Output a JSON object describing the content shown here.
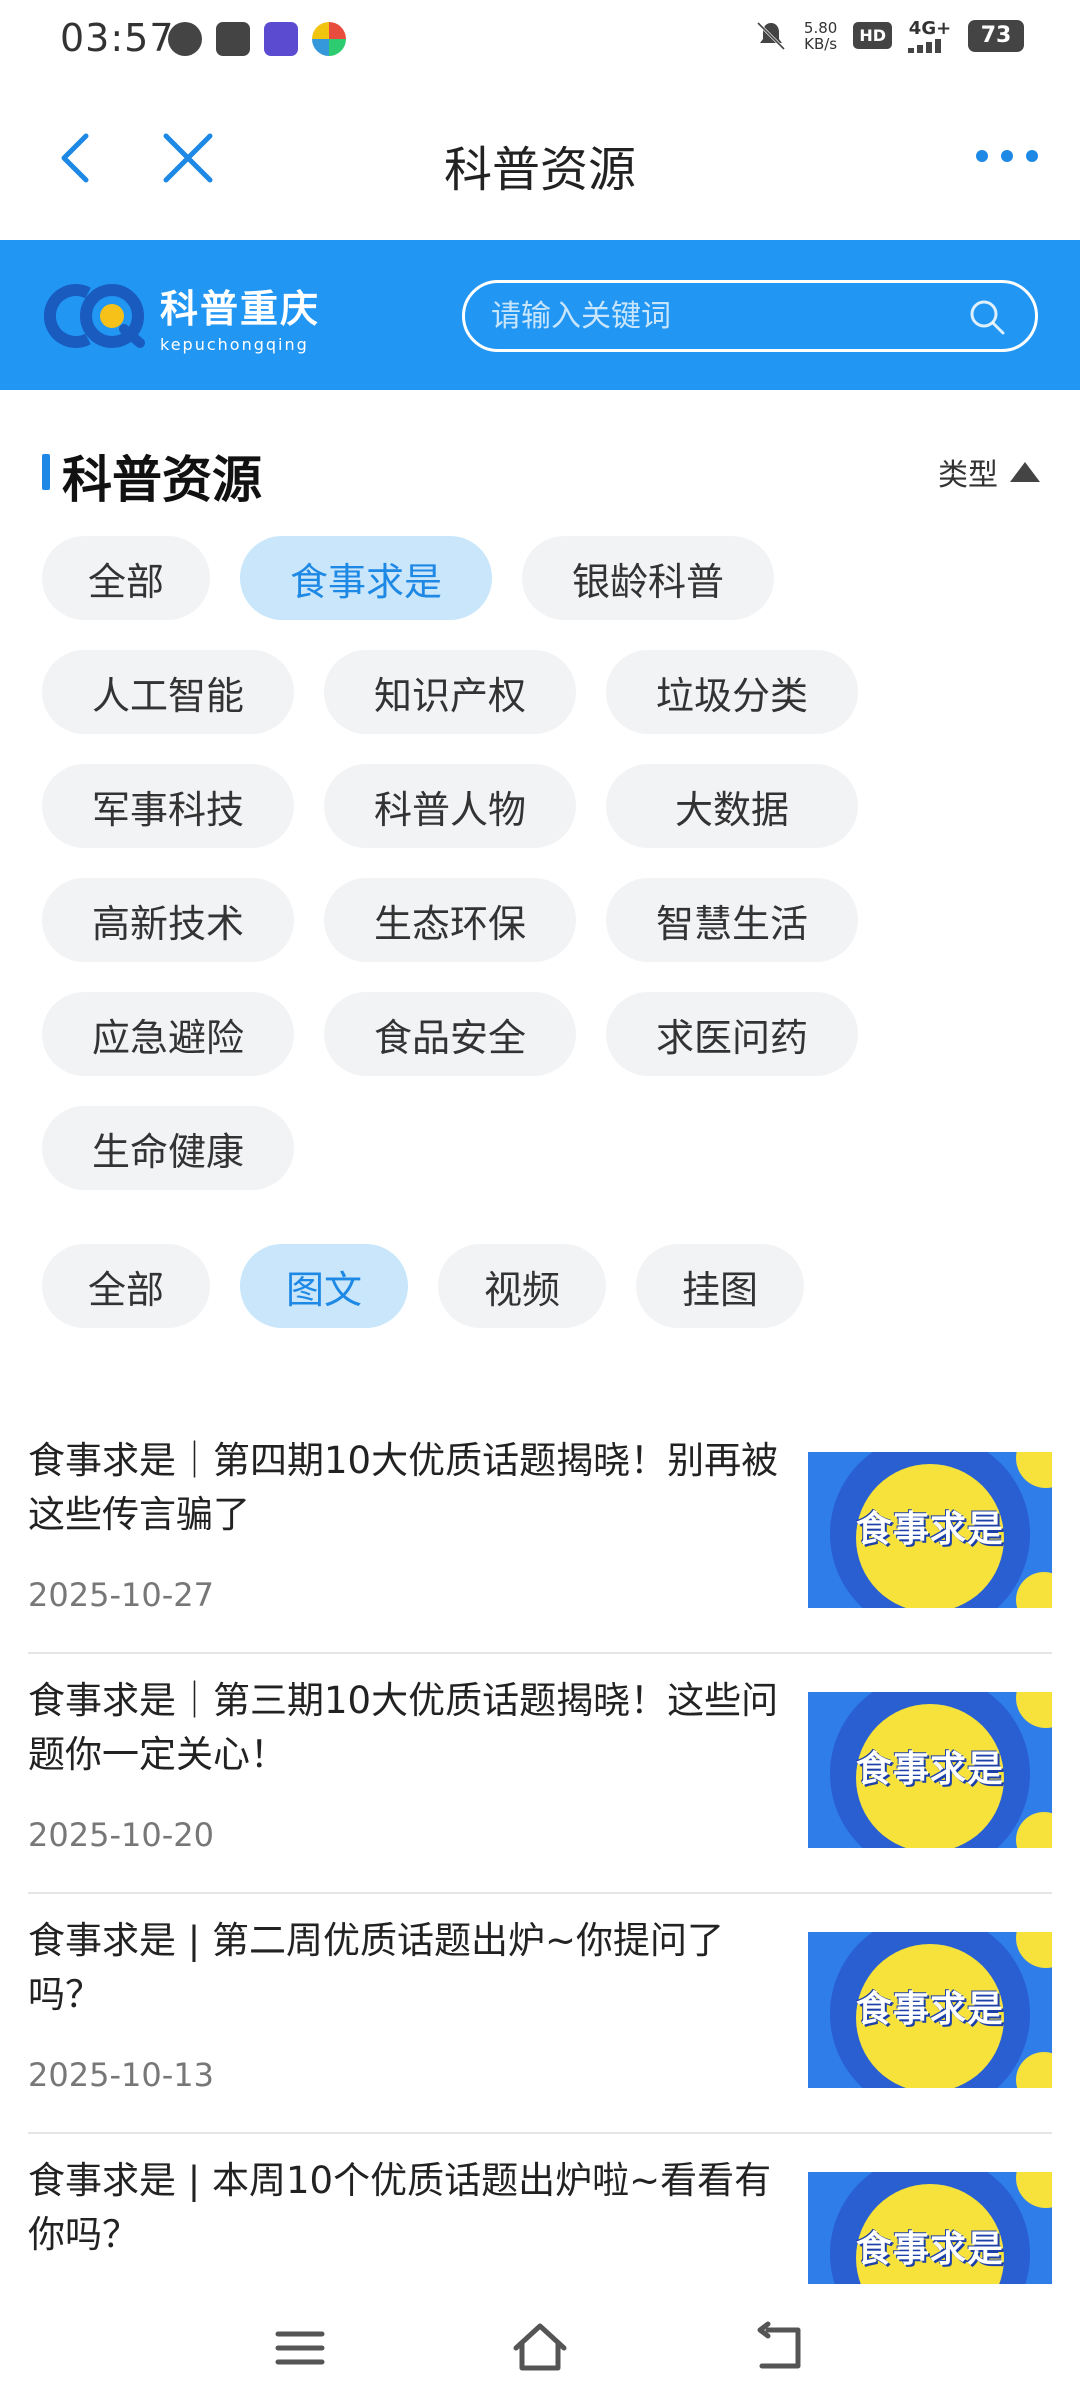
{
  "status_bar": {
    "time": "03:57",
    "net_speed_value": "5.80",
    "net_speed_unit": "KB/s",
    "hd_label": "HD",
    "network_label": "4G+",
    "battery": "73",
    "left_icons": [
      "chat-icon",
      "message-icon",
      "app-icon",
      "colorful-app-icon"
    ],
    "right_icons": [
      "mute-icon",
      "signal-icon",
      "battery-icon"
    ]
  },
  "header": {
    "title": "科普资源",
    "icons": [
      "back-icon",
      "close-icon",
      "more-icon"
    ]
  },
  "banner": {
    "logo_cn": "科普重庆",
    "logo_en": "kepuchongqing",
    "search_placeholder": "请输入关键词",
    "accent": "#2196f3"
  },
  "section": {
    "title": "科普资源",
    "type_label": "类型"
  },
  "categories": [
    {
      "label": "全部",
      "active": false
    },
    {
      "label": "食事求是",
      "active": true
    },
    {
      "label": "银龄科普",
      "active": false
    },
    {
      "label": "人工智能",
      "active": false
    },
    {
      "label": "知识产权",
      "active": false
    },
    {
      "label": "垃圾分类",
      "active": false
    },
    {
      "label": "军事科技",
      "active": false
    },
    {
      "label": "科普人物",
      "active": false
    },
    {
      "label": "大数据",
      "active": false
    },
    {
      "label": "高新技术",
      "active": false
    },
    {
      "label": "生态环保",
      "active": false
    },
    {
      "label": "智慧生活",
      "active": false
    },
    {
      "label": "应急避险",
      "active": false
    },
    {
      "label": "食品安全",
      "active": false
    },
    {
      "label": "求医问药",
      "active": false
    },
    {
      "label": "生命健康",
      "active": false
    }
  ],
  "content_types": [
    {
      "label": "全部",
      "active": false
    },
    {
      "label": "图文",
      "active": true
    },
    {
      "label": "视频",
      "active": false
    },
    {
      "label": "挂图",
      "active": false
    }
  ],
  "articles": [
    {
      "title": "食事求是｜第四期10大优质话题揭晓！别再被这些传言骗了",
      "date": "2025-10-27",
      "thumb_text": "食事求是"
    },
    {
      "title": "食事求是｜第三期10大优质话题揭晓！这些问题你一定关心！",
      "date": "2025-10-20",
      "thumb_text": "食事求是"
    },
    {
      "title": "食事求是 | 第二周优质话题出炉~你提问了吗？",
      "date": "2025-10-13",
      "thumb_text": "食事求是"
    },
    {
      "title": "食事求是 | 本周10个优质话题出炉啦~看看有你吗？",
      "date": "",
      "thumb_text": "食事求是"
    }
  ],
  "nav": {
    "icons": [
      "menu-icon",
      "home-icon",
      "back-nav-icon"
    ]
  }
}
